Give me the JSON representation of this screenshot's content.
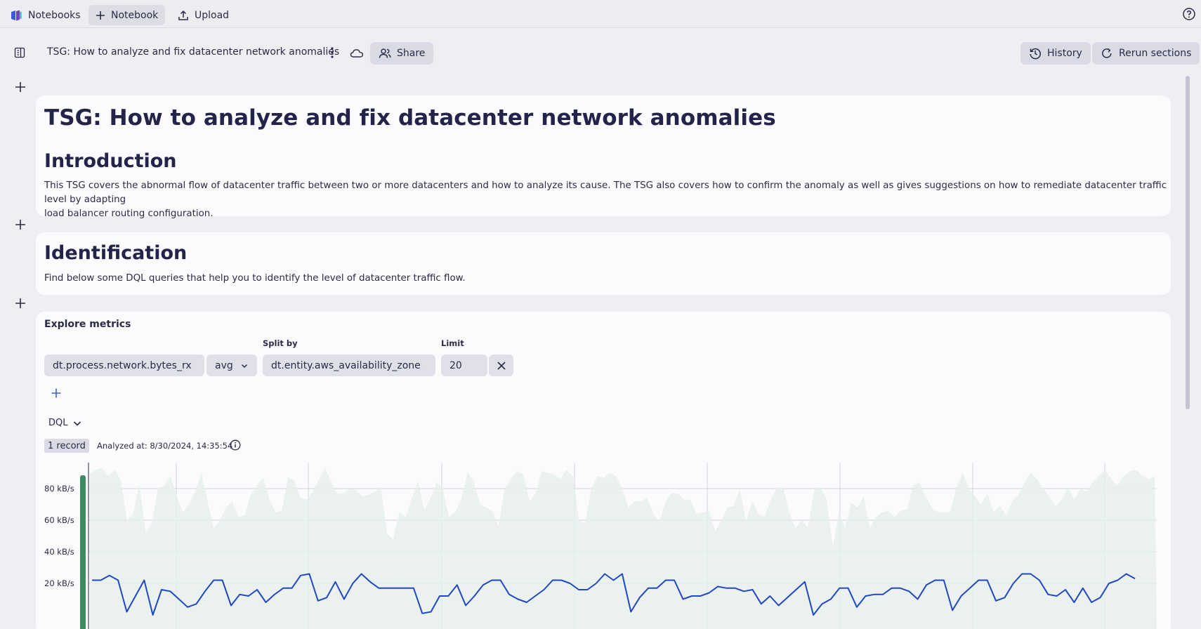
{
  "topbar": {
    "notebooks_label": "Notebooks",
    "new_notebook_label": "Notebook",
    "upload_label": "Upload"
  },
  "header": {
    "title": "TSG: How to analyze and fix datacenter network anomalies",
    "share_label": "Share",
    "history_label": "History",
    "rerun_label": "Rerun sections"
  },
  "intro_section": {
    "title": "TSG: How to analyze and fix datacenter network anomalies",
    "heading": "Introduction",
    "body_line1": "This TSG covers the abnormal flow of datacenter traffic between two or more datacenters and how to analyze its cause. The TSG also covers how to confirm the anomaly as well as gives suggestions on how to remediate datacenter traffic level by adapting",
    "body_line2": "load balancer routing configuration."
  },
  "ident_section": {
    "heading": "Identification",
    "body": "Find below some DQL queries that help you to identify the level of datacenter traffic flow."
  },
  "metrics_section": {
    "label": "Explore metrics",
    "metric_value": "dt.process.network.bytes_rx",
    "aggregation_value": "avg",
    "split_by_label": "Split by",
    "split_by_value": "dt.entity.aws_availability_zone",
    "limit_label": "Limit",
    "limit_value": "20",
    "query_mode": "DQL",
    "records_badge": "1 record",
    "analyzed_at": "Analyzed at: 8/30/2024, 14:35:54"
  },
  "icons": {
    "notebooks": "notebooks-logo-icon",
    "plus": "plus-icon",
    "upload": "upload-icon",
    "help": "help-icon",
    "sidebar": "sidebar-toggle-icon",
    "kebab": "more-vertical-icon",
    "cloud": "cloud-sync-icon",
    "share": "users-icon",
    "history": "history-icon",
    "rerun": "refresh-icon",
    "chevron": "chevron-down-icon",
    "close": "close-icon",
    "info": "info-icon"
  },
  "chart_data": {
    "type": "line",
    "yaxis_ticks": [
      "80 kB/s",
      "60 kB/s",
      "40 kB/s",
      "20 kB/s"
    ],
    "ylim_kBps": [
      0,
      95
    ],
    "grid": true,
    "colors": {
      "line": "#2148c0",
      "band": "#e6efeb",
      "marker": "#3f8a63"
    },
    "series": [
      {
        "values": [
          22,
          22,
          25,
          22,
          2,
          12,
          22,
          0,
          16,
          15,
          10,
          5,
          7,
          15,
          22,
          22,
          6,
          13,
          12,
          16,
          8,
          13,
          17,
          17,
          25,
          26,
          9,
          11,
          21,
          10,
          20,
          26,
          21,
          17,
          17,
          17,
          17,
          17,
          1,
          2,
          12,
          12,
          19,
          6,
          12,
          19,
          22,
          22,
          13,
          10,
          8,
          12,
          16,
          22,
          22,
          20,
          16,
          16,
          20,
          26,
          22,
          26,
          2,
          11,
          17,
          17,
          22,
          22,
          10,
          12,
          12,
          14,
          18,
          17,
          17,
          15,
          16,
          7,
          12,
          6,
          11,
          16,
          21,
          0,
          7,
          10,
          17,
          17,
          5,
          12,
          13,
          13,
          17,
          17,
          15,
          10,
          19,
          22,
          22,
          3,
          12,
          17,
          22,
          22,
          9,
          11,
          20,
          26,
          26,
          22,
          13,
          12,
          16,
          8,
          17,
          8,
          11,
          20,
          22,
          26,
          23
        ],
        "band_upper": [
          89,
          92,
          93,
          88,
          92,
          85,
          60,
          64,
          83,
          52,
          58,
          80,
          82,
          88,
          76,
          65,
          70,
          78,
          90,
          72,
          55,
          60,
          68,
          72,
          62,
          63,
          76,
          82,
          87,
          73,
          65,
          66,
          87,
          85,
          74,
          73,
          78,
          86,
          93,
          84,
          77,
          77,
          80,
          79,
          75,
          76,
          78,
          81,
          51,
          48,
          65,
          62,
          74,
          85,
          66,
          74,
          84,
          80,
          62,
          65,
          73,
          90,
          85,
          70,
          68,
          66,
          56,
          80,
          86,
          91,
          89,
          72,
          77,
          91,
          90,
          89,
          86,
          92,
          88,
          60,
          58,
          80,
          88,
          87,
          90,
          88,
          80,
          68,
          72,
          72,
          74,
          64,
          59,
          72,
          77,
          77,
          73,
          73,
          64,
          65,
          66,
          53,
          60,
          68,
          69,
          80,
          59,
          72,
          64,
          62,
          73,
          81,
          80,
          65,
          55,
          60,
          55,
          79,
          81,
          73,
          43,
          65,
          55,
          71,
          68,
          75,
          55,
          62,
          65,
          66,
          62,
          66,
          67,
          82,
          84,
          75,
          68,
          65,
          65,
          65,
          81,
          90,
          80,
          75,
          70,
          77,
          65,
          69,
          63,
          72,
          76,
          84,
          90,
          86,
          80,
          75,
          69,
          73,
          81,
          73,
          80,
          78,
          84,
          88,
          92,
          86,
          82,
          88,
          91,
          92,
          88,
          86,
          88
        ]
      }
    ]
  }
}
